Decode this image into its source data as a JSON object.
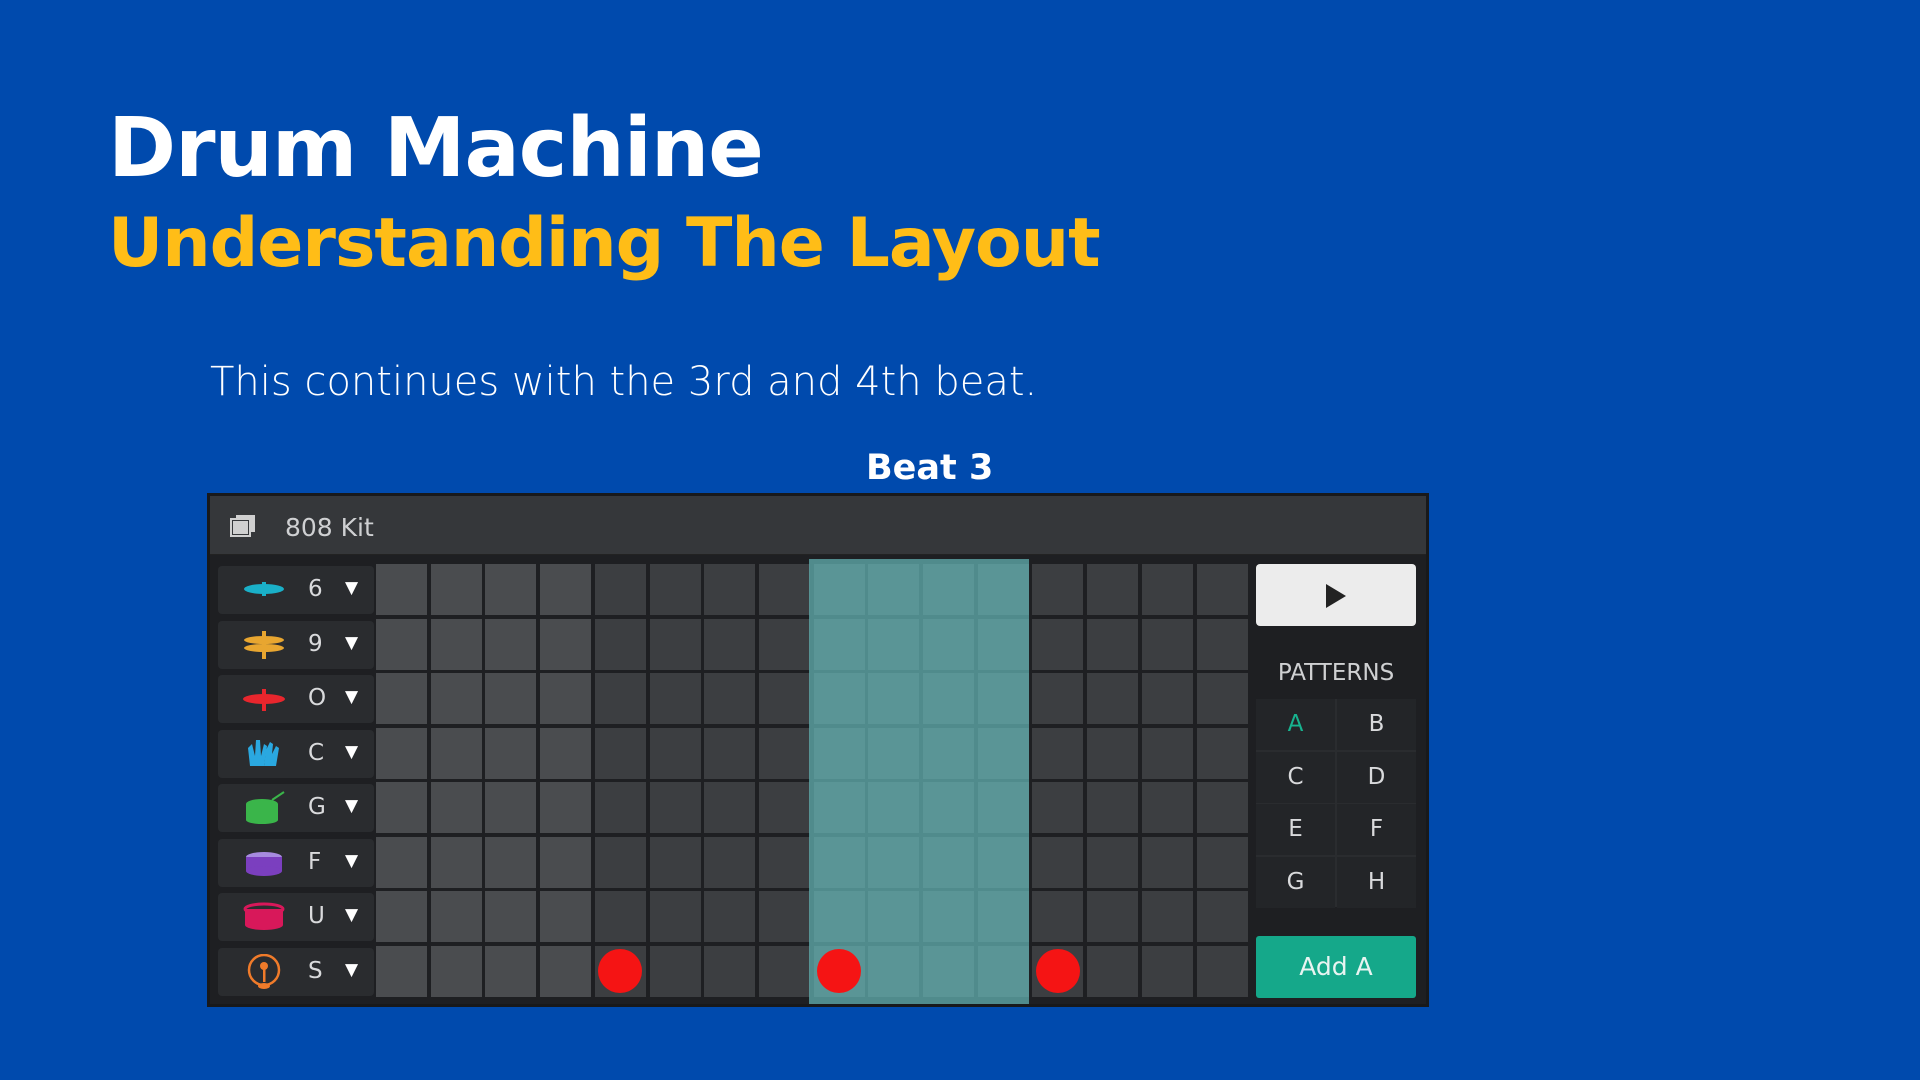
{
  "slide": {
    "title": "Drum Machine",
    "subtitle": "Understanding The Layout",
    "body": "This continues with the 3rd and 4th beat.",
    "beat_label": "Beat 3"
  },
  "machine": {
    "kit_label": "808 Kit",
    "tracks": [
      {
        "key": "6",
        "icon": "cymbal-icon",
        "color": "#1ab0c8"
      },
      {
        "key": "9",
        "icon": "hihat-icon",
        "color": "#e8a630"
      },
      {
        "key": "O",
        "icon": "open-hihat-icon",
        "color": "#e8262d"
      },
      {
        "key": "C",
        "icon": "clap-icon",
        "color": "#2aa8e0"
      },
      {
        "key": "G",
        "icon": "tom-drum-icon",
        "color": "#3ab54a"
      },
      {
        "key": "F",
        "icon": "snare-drum-icon",
        "color": "#7b3fbf"
      },
      {
        "key": "U",
        "icon": "bass-drum-icon",
        "color": "#d8185a"
      },
      {
        "key": "S",
        "icon": "kick-pedal-icon",
        "color": "#f07b2a"
      }
    ],
    "steps": 16,
    "highlighted_beat": 3,
    "active_steps_row_8": [
      5,
      9,
      13
    ],
    "play_label": "play",
    "patterns_label": "PATTERNS",
    "patterns": [
      "A",
      "B",
      "C",
      "D",
      "E",
      "F",
      "G",
      "H"
    ],
    "active_pattern": "A",
    "add_label": "Add A",
    "colors": {
      "background": "#004aad",
      "subtitle": "#ffbd17",
      "highlight": "#5faaaa",
      "hit": "#f51414",
      "add_button": "#15a88a"
    }
  }
}
